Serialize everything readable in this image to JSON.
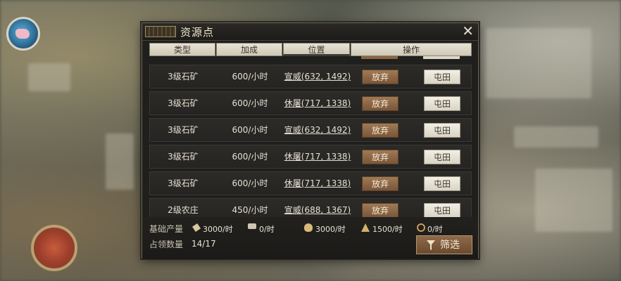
{
  "dialog": {
    "title": "资源点",
    "close_glyph": "✕",
    "columns": [
      "类型",
      "加成",
      "位置",
      "操作"
    ]
  },
  "rows": [
    {
      "type": "3级石矿",
      "bonus": "600/小时",
      "position": "宣威(632, 1492)",
      "abandon": "放弃",
      "farm": "屯田"
    },
    {
      "type": "3级石矿",
      "bonus": "600/小时",
      "position": "休屠(717, 1338)",
      "abandon": "放弃",
      "farm": "屯田"
    },
    {
      "type": "3级石矿",
      "bonus": "600/小时",
      "position": "宣威(632, 1492)",
      "abandon": "放弃",
      "farm": "屯田"
    },
    {
      "type": "3级石矿",
      "bonus": "600/小时",
      "position": "休屠(717, 1338)",
      "abandon": "放弃",
      "farm": "屯田"
    },
    {
      "type": "3级石矿",
      "bonus": "600/小时",
      "position": "休屠(717, 1338)",
      "abandon": "放弃",
      "farm": "屯田"
    },
    {
      "type": "2级农庄",
      "bonus": "450/小时",
      "position": "宣威(688, 1367)",
      "abandon": "放弃",
      "farm": "屯田"
    }
  ],
  "footer": {
    "base_label": "基础产量",
    "production": {
      "wood": "3000/时",
      "iron": "0/时",
      "stone": "3000/时",
      "grain": "1500/时",
      "copper": "0/时"
    },
    "occupied_label": "占领数量",
    "occupied_value": "14/17",
    "filter_label": "筛选"
  },
  "icons": [
    "avatar-icon",
    "wood-icon",
    "iron-icon",
    "stone-icon",
    "grain-icon",
    "copper-icon",
    "filter-icon",
    "close-icon"
  ],
  "colors": {
    "panel_bg": "#1f1f1d",
    "abandon_button": "#8a6544",
    "farm_button": "#e6e1d4",
    "filter_button": "#7a5a3c"
  }
}
